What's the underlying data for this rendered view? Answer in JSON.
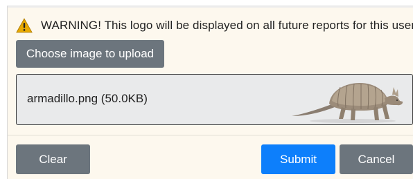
{
  "warning": {
    "icon": "warning-triangle-icon",
    "text": "WARNING! This logo will be displayed on all future reports for this user"
  },
  "upload": {
    "button_label": "Choose image to upload"
  },
  "file": {
    "name_size": "armadillo.png (50.0KB)",
    "preview_icon": "armadillo-image"
  },
  "actions": {
    "clear_label": "Clear",
    "submit_label": "Submit",
    "cancel_label": "Cancel"
  },
  "colors": {
    "background": "#fdf8ee",
    "secondary_button": "#6c757d",
    "primary_button": "#0d7ffb",
    "warning_icon": "#e5a700"
  }
}
